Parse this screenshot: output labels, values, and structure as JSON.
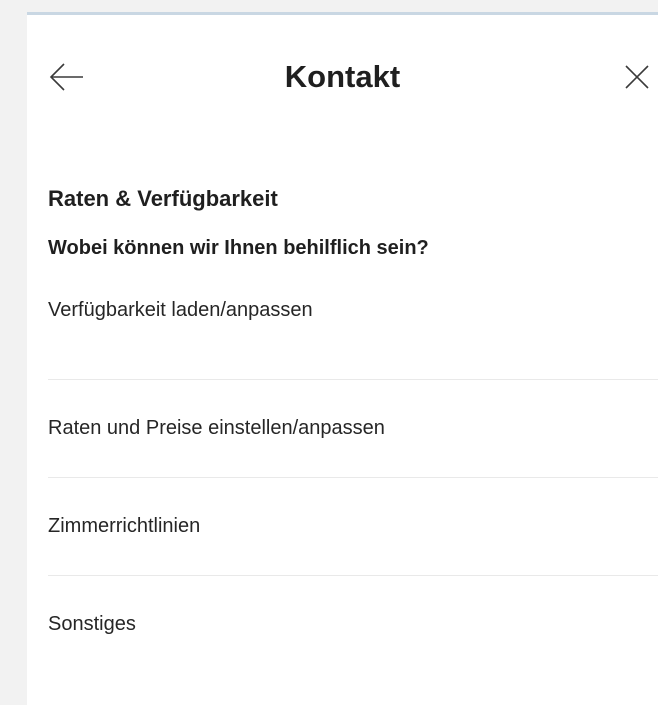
{
  "header": {
    "title": "Kontakt",
    "back_icon": "arrow-left-icon",
    "close_icon": "close-icon"
  },
  "section": {
    "title": "Raten & Verfügbarkeit",
    "subtitle": "Wobei können wir Ihnen behilflich sein?"
  },
  "options": [
    {
      "label": "Verfügbarkeit laden/anpassen"
    },
    {
      "label": "Raten und Preise einstellen/anpassen"
    },
    {
      "label": "Zimmerrichtlinien"
    },
    {
      "label": "Sonstiges"
    }
  ],
  "colors": {
    "background": "#f2f2f2",
    "panel": "#ffffff",
    "top_border": "#c9d7e3",
    "divider": "#e9e9e9",
    "text": "#1f1f1f"
  }
}
